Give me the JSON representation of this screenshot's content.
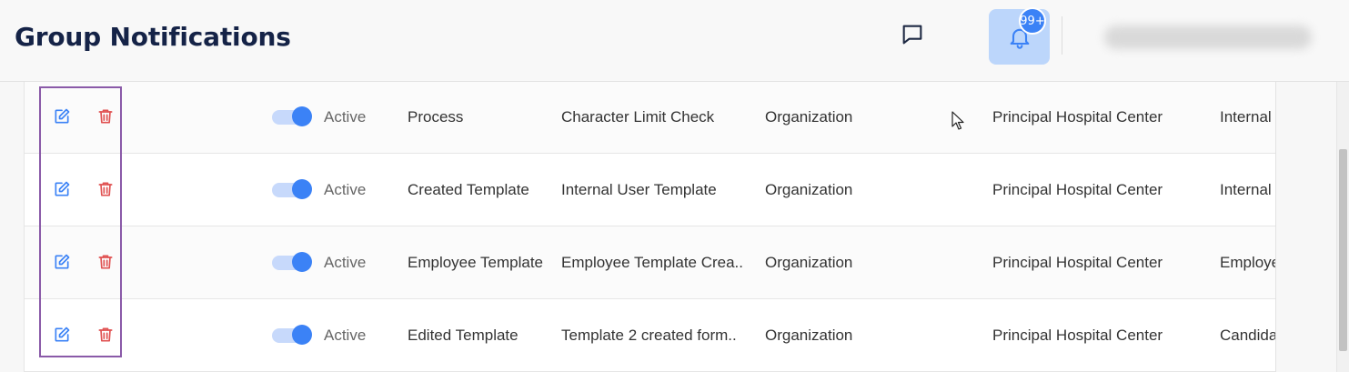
{
  "header": {
    "title": "Group Notifications",
    "notification_count": "99+"
  },
  "rows": [
    {
      "status": "Active",
      "type": "Process",
      "template": "Character Limit Check",
      "level": "Organization",
      "organization": "Principal Hospital Center",
      "audience": "Internal"
    },
    {
      "status": "Active",
      "type": "Created Template",
      "template": "Internal User Template",
      "level": "Organization",
      "organization": "Principal Hospital Center",
      "audience": "Internal"
    },
    {
      "status": "Active",
      "type": "Employee Template",
      "template": "Employee Template Crea..",
      "level": "Organization",
      "organization": "Principal Hospital Center",
      "audience": "Employe"
    },
    {
      "status": "Active",
      "type": "Edited Template",
      "template": "Template 2 created form..",
      "level": "Organization",
      "organization": "Principal Hospital Center",
      "audience": "Candida"
    }
  ],
  "colors": {
    "accent": "#3b82f6",
    "delete": "#e05252",
    "title": "#152347",
    "highlight": "#8a5aa8"
  },
  "icons": [
    "chat-icon",
    "bell-icon",
    "edit-icon",
    "trash-icon",
    "mouse-cursor-icon"
  ]
}
